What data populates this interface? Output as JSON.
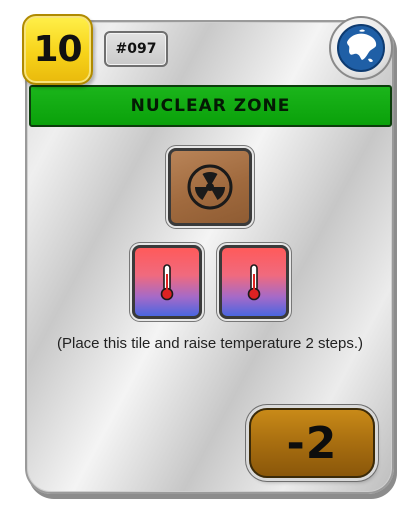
{
  "card": {
    "cost": "10",
    "tag": "#097",
    "title": "NUCLEAR ZONE",
    "description": "(Place this tile and raise temperature 2 steps.)",
    "victory_points": "-2",
    "icons": {
      "badge": "globe-asia-icon",
      "tile": "radiation-icon",
      "temperature": "thermometer-icon"
    },
    "colors": {
      "title_bar": "#0aa10a",
      "cost_badge": "#f7d31a",
      "tile": "#a06a3e",
      "vp_badge": "#a86e10"
    }
  }
}
